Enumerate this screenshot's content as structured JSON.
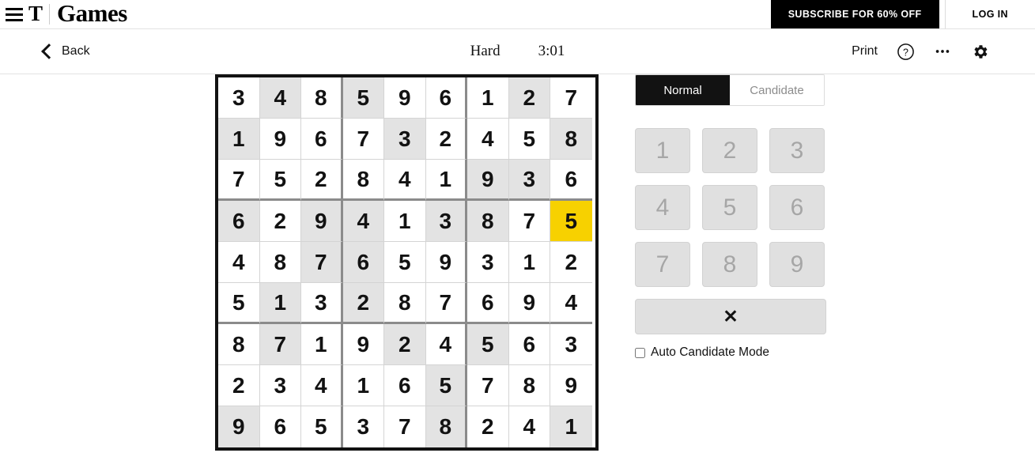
{
  "masthead": {
    "menu_icon": "hamburger-icon",
    "logo_mark": "T",
    "logo_word": "Games",
    "subscribe_label": "SUBSCRIBE FOR 60% OFF",
    "login_label": "LOG IN"
  },
  "toolbar": {
    "back_label": "Back",
    "back_icon": "chevron-left-icon",
    "difficulty": "Hard",
    "timer": "3:01",
    "print_label": "Print",
    "help_icon": "question-circle-icon",
    "more_icon": "ellipsis-icon",
    "settings_icon": "gear-icon"
  },
  "board": {
    "selected": {
      "row": 3,
      "col": 8
    },
    "selected_color": "#f7d100",
    "shaded_color": "#e3e3e3",
    "rows": [
      {
        "values": [
          "3",
          "4",
          "8",
          "5",
          "9",
          "6",
          "1",
          "2",
          "7"
        ],
        "shaded": [
          false,
          true,
          false,
          true,
          false,
          false,
          false,
          true,
          false
        ]
      },
      {
        "values": [
          "1",
          "9",
          "6",
          "7",
          "3",
          "2",
          "4",
          "5",
          "8"
        ],
        "shaded": [
          true,
          false,
          false,
          false,
          true,
          false,
          false,
          false,
          true
        ]
      },
      {
        "values": [
          "7",
          "5",
          "2",
          "8",
          "4",
          "1",
          "9",
          "3",
          "6"
        ],
        "shaded": [
          false,
          false,
          false,
          false,
          false,
          false,
          true,
          true,
          false
        ]
      },
      {
        "values": [
          "6",
          "2",
          "9",
          "4",
          "1",
          "3",
          "8",
          "7",
          "5"
        ],
        "shaded": [
          true,
          false,
          true,
          true,
          false,
          true,
          true,
          false,
          false
        ]
      },
      {
        "values": [
          "4",
          "8",
          "7",
          "6",
          "5",
          "9",
          "3",
          "1",
          "2"
        ],
        "shaded": [
          false,
          false,
          true,
          true,
          false,
          false,
          false,
          false,
          false
        ]
      },
      {
        "values": [
          "5",
          "1",
          "3",
          "2",
          "8",
          "7",
          "6",
          "9",
          "4"
        ],
        "shaded": [
          false,
          true,
          false,
          true,
          false,
          false,
          false,
          false,
          false
        ]
      },
      {
        "values": [
          "8",
          "7",
          "1",
          "9",
          "2",
          "4",
          "5",
          "6",
          "3"
        ],
        "shaded": [
          false,
          true,
          false,
          false,
          true,
          false,
          true,
          false,
          false
        ]
      },
      {
        "values": [
          "2",
          "3",
          "4",
          "1",
          "6",
          "5",
          "7",
          "8",
          "9"
        ],
        "shaded": [
          false,
          false,
          false,
          false,
          false,
          true,
          false,
          false,
          false
        ]
      },
      {
        "values": [
          "9",
          "6",
          "5",
          "3",
          "7",
          "8",
          "2",
          "4",
          "1"
        ],
        "shaded": [
          true,
          false,
          false,
          false,
          false,
          true,
          false,
          false,
          true
        ]
      }
    ]
  },
  "controls": {
    "mode_normal": "Normal",
    "mode_candidate": "Candidate",
    "active_mode": "Normal",
    "numbers": [
      "1",
      "2",
      "3",
      "4",
      "5",
      "6",
      "7",
      "8",
      "9"
    ],
    "erase_label": "✕",
    "erase_icon": "x-icon",
    "auto_candidate_label": "Auto Candidate Mode",
    "auto_candidate_checked": false
  }
}
